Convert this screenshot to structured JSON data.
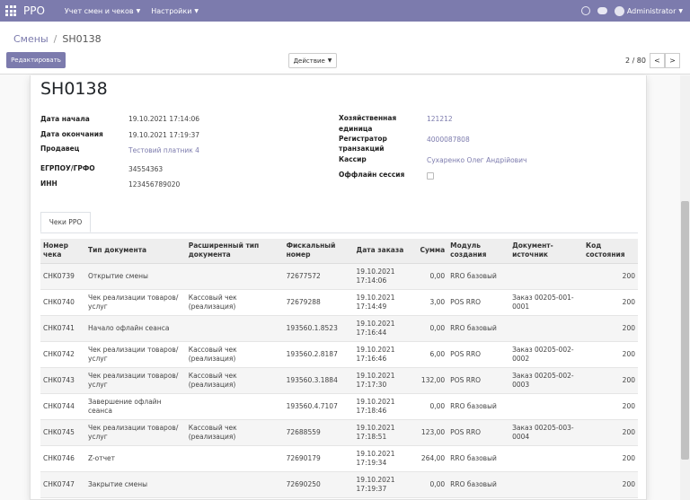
{
  "app": {
    "brand": "РРО"
  },
  "menu": [
    {
      "label": "Учет смен и чеков"
    },
    {
      "label": "Настройки"
    }
  ],
  "user": {
    "name": "Administrator"
  },
  "breadcrumb": {
    "parent": "Смены",
    "separator": "/",
    "current": "SH0138"
  },
  "buttons": {
    "edit": "Редактировать",
    "action": "Действие"
  },
  "pager": {
    "value": "2 / 80",
    "prev": "<",
    "next": ">"
  },
  "record": {
    "title": "SH0138",
    "left_fields": [
      {
        "label": "Дата начала",
        "value": "19.10.2021 17:14:06"
      },
      {
        "label": "Дата окончания",
        "value": "19.10.2021 17:19:37"
      },
      {
        "label": "Продавец",
        "value": "Тестовий платник 4"
      },
      {
        "label": "ЕГРПОУ/ГРФО",
        "value": "34554363"
      },
      {
        "label": "ИНН",
        "value": "123456789020"
      }
    ],
    "right_fields": [
      {
        "label1": "Хозяйственная",
        "label2": "единица",
        "value": "121212"
      },
      {
        "label1": "Регистратор",
        "label2": "транзакций",
        "value": "4000087808"
      },
      {
        "label": "Кассир",
        "value": "Сухаренко Олег Андрійович"
      },
      {
        "label": "Оффлайн сессия",
        "checked": false
      }
    ]
  },
  "tabs": [
    {
      "label": "Чеки РРО"
    }
  ],
  "table": {
    "headers": [
      [
        "Номер",
        "чека"
      ],
      [
        "Тип документа",
        ""
      ],
      [
        "Расширенный тип",
        "документа"
      ],
      [
        "Фискальный",
        "номер"
      ],
      [
        "Дата заказа",
        ""
      ],
      [
        "Сумма",
        ""
      ],
      [
        "Модуль",
        "создания"
      ],
      [
        "Документ-источник",
        ""
      ],
      [
        "Код",
        "состояния"
      ]
    ],
    "rows": [
      {
        "num": "CHK0739",
        "type": [
          "Открытие смены",
          ""
        ],
        "ext": [
          "",
          ""
        ],
        "fiscal": "72677572",
        "date": [
          "19.10.2021",
          "17:14:06"
        ],
        "sum": "0,00",
        "module": "RRO базовый",
        "source": [
          "",
          ""
        ],
        "code": "200"
      },
      {
        "num": "CHK0740",
        "type": [
          "Чек реализации товаров/",
          "услуг"
        ],
        "ext": [
          "Кассовый чек",
          "(реализация)"
        ],
        "fiscal": "72679288",
        "date": [
          "19.10.2021",
          "17:14:49"
        ],
        "sum": "3,00",
        "module": "POS RRO",
        "source": [
          "Заказ 00205-001-",
          "0001"
        ],
        "code": "200"
      },
      {
        "num": "CHK0741",
        "type": [
          "Начало офлайн сеанса",
          ""
        ],
        "ext": [
          "",
          ""
        ],
        "fiscal": "193560.1.8523",
        "date": [
          "19.10.2021",
          "17:16:44"
        ],
        "sum": "0,00",
        "module": "RRO базовый",
        "source": [
          "",
          ""
        ],
        "code": "200"
      },
      {
        "num": "CHK0742",
        "type": [
          "Чек реализации товаров/",
          "услуг"
        ],
        "ext": [
          "Кассовый чек",
          "(реализация)"
        ],
        "fiscal": "193560.2.8187",
        "date": [
          "19.10.2021",
          "17:16:46"
        ],
        "sum": "6,00",
        "module": "POS RRO",
        "source": [
          "Заказ 00205-002-",
          "0002"
        ],
        "code": "200"
      },
      {
        "num": "CHK0743",
        "type": [
          "Чек реализации товаров/",
          "услуг"
        ],
        "ext": [
          "Кассовый чек",
          "(реализация)"
        ],
        "fiscal": "193560.3.1884",
        "date": [
          "19.10.2021",
          "17:17:30"
        ],
        "sum": "132,00",
        "module": "POS RRO",
        "source": [
          "Заказ 00205-002-",
          "0003"
        ],
        "code": "200"
      },
      {
        "num": "CHK0744",
        "type": [
          "Завершение офлайн сеанса",
          ""
        ],
        "ext": [
          "",
          ""
        ],
        "fiscal": "193560.4.7107",
        "date": [
          "19.10.2021",
          "17:18:46"
        ],
        "sum": "0,00",
        "module": "RRO базовый",
        "source": [
          "",
          ""
        ],
        "code": "200"
      },
      {
        "num": "CHK0745",
        "type": [
          "Чек реализации товаров/",
          "услуг"
        ],
        "ext": [
          "Кассовый чек",
          "(реализация)"
        ],
        "fiscal": "72688559",
        "date": [
          "19.10.2021",
          "17:18:51"
        ],
        "sum": "123,00",
        "module": "POS RRO",
        "source": [
          "Заказ 00205-003-",
          "0004"
        ],
        "code": "200"
      },
      {
        "num": "CHK0746",
        "type": [
          "Z-отчет",
          ""
        ],
        "ext": [
          "",
          ""
        ],
        "fiscal": "72690179",
        "date": [
          "19.10.2021",
          "17:19:34"
        ],
        "sum": "264,00",
        "module": "RRO базовый",
        "source": [
          "",
          ""
        ],
        "code": "200"
      },
      {
        "num": "CHK0747",
        "type": [
          "Закрытие смены",
          ""
        ],
        "ext": [
          "",
          ""
        ],
        "fiscal": "72690250",
        "date": [
          "19.10.2021",
          "17:19:37"
        ],
        "sum": "0,00",
        "module": "RRO базовый",
        "source": [
          "",
          ""
        ],
        "code": "200"
      }
    ]
  }
}
